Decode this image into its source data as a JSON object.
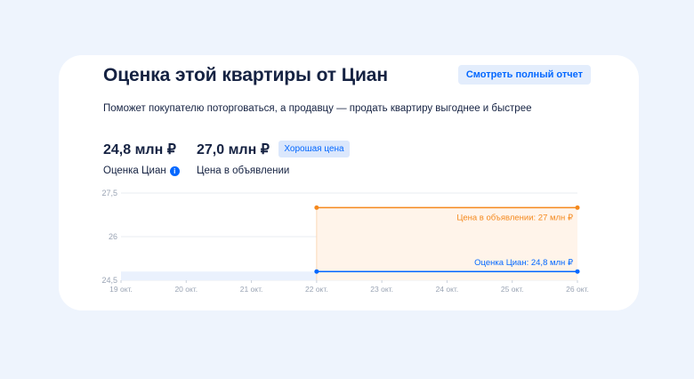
{
  "card": {
    "title": "Оценка этой квартиры от Циан",
    "report_button": "Смотреть полный отчет",
    "subtitle": "Поможет покупателю поторговаться, а продавцу — продать квартиру выгоднее и быстрее"
  },
  "estimate": {
    "value": "24,8 млн ₽",
    "label": "Оценка Циан",
    "icon": "info-icon"
  },
  "listing": {
    "value": "27,0 млн ₽",
    "label": "Цена в объявлении",
    "badge": "Хорошая цена"
  },
  "colors": {
    "accent": "#0468ff",
    "orange": "#f5891d",
    "title": "#152242"
  },
  "chart_data": {
    "type": "line",
    "x": [
      "19 окт.",
      "20 окт.",
      "21 окт.",
      "22 окт.",
      "23 окт.",
      "24 окт.",
      "25 окт.",
      "26 окт."
    ],
    "yticks": [
      "27,5",
      "26",
      "24,5"
    ],
    "ylim": [
      24.5,
      27.5
    ],
    "grid": true,
    "series": [
      {
        "name": "Цена в объявлении: 27 млн ₽",
        "color": "#f5891d",
        "x_start": "22 окт.",
        "x_end": "26 окт.",
        "values": [
          27.0,
          27.0
        ]
      },
      {
        "name": "Оценка Циан: 24,8 млн ₽",
        "color": "#0468ff",
        "x_start": "22 окт.",
        "x_end": "26 окт.",
        "values": [
          24.8,
          24.8
        ]
      }
    ]
  }
}
